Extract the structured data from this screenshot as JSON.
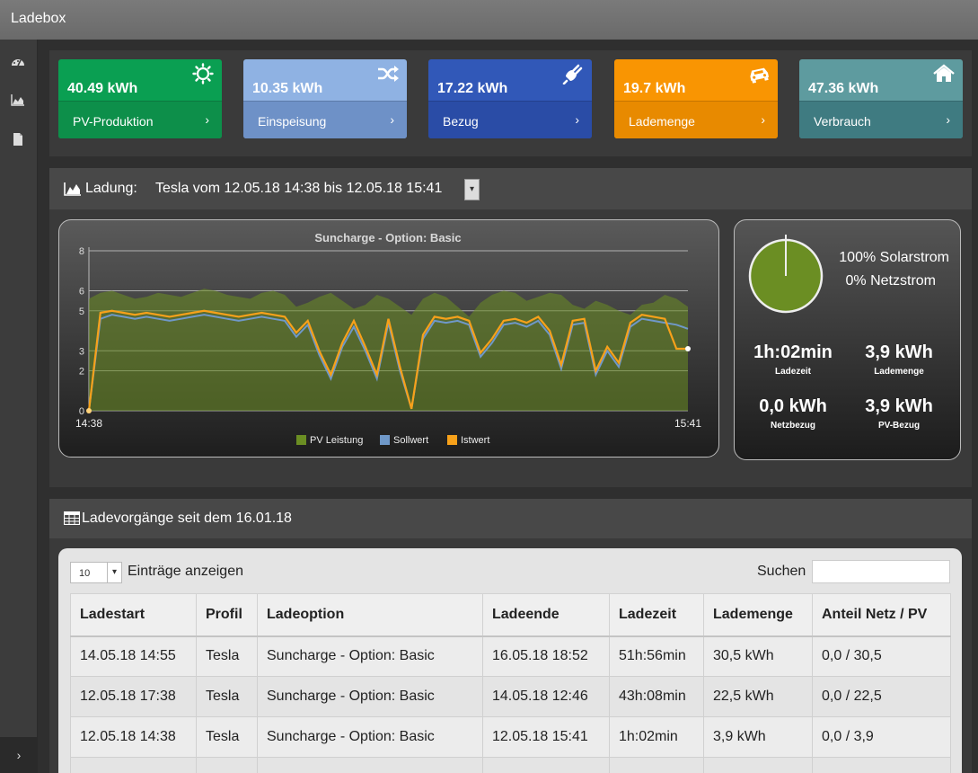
{
  "app": {
    "title": "Ladebox"
  },
  "sidebar": {
    "items": [
      {
        "icon": "dashboard-icon"
      },
      {
        "icon": "area-chart-icon"
      },
      {
        "icon": "document-icon"
      }
    ],
    "toggle_label": "›"
  },
  "tiles": [
    {
      "value": "40.49 kWh",
      "label": "PV-Produktion",
      "color": "#0a9f52",
      "foot_color": "#0d8f4a",
      "icon": "sun-icon"
    },
    {
      "value": "10.35 kWh",
      "label": "Einspeisung",
      "color": "#8fb2e3",
      "foot_color": "#6e91c7",
      "icon": "shuffle-icon"
    },
    {
      "value": "17.22 kWh",
      "label": "Bezug",
      "color": "#3158b8",
      "foot_color": "#2a4ca6",
      "icon": "plug-icon"
    },
    {
      "value": "19.7 kWh",
      "label": "Lademenge",
      "color": "#f99502",
      "foot_color": "#e88a00",
      "icon": "car-icon"
    },
    {
      "value": "47.36 kWh",
      "label": "Verbrauch",
      "color": "#5e9b9f",
      "foot_color": "#3f7b81",
      "icon": "home-icon"
    }
  ],
  "tile_chevron": "›",
  "ladung": {
    "label": "Ladung:",
    "session": "Tesla vom 12.05.18 14:38 bis 12.05.18 15:41",
    "dropdown_icon": "chevron-down-icon"
  },
  "chart_data": {
    "type": "area",
    "title": "Suncharge - Option: Basic",
    "x_start_label": "14:38",
    "x_end_label": "15:41",
    "ylim": [
      0,
      8
    ],
    "yticks": [
      0,
      2,
      3,
      5,
      6,
      8
    ],
    "grid": true,
    "legend_placement": "bottom",
    "series": [
      {
        "name": "PV Leistung",
        "type": "area",
        "color": "#6b8e23",
        "values": [
          5.6,
          5.9,
          6.0,
          5.8,
          5.6,
          5.7,
          5.9,
          5.8,
          5.7,
          5.9,
          6.1,
          6.0,
          5.8,
          5.7,
          5.6,
          5.9,
          6.0,
          5.8,
          5.2,
          5.4,
          5.7,
          5.9,
          5.5,
          5.1,
          5.3,
          5.8,
          5.6,
          5.2,
          4.8,
          5.6,
          5.9,
          5.7,
          5.2,
          4.7,
          5.4,
          5.8,
          6.0,
          5.9,
          5.5,
          5.7,
          5.9,
          5.8,
          5.3,
          5.1,
          5.5,
          5.3,
          5.0,
          4.8,
          5.3,
          5.4,
          5.8,
          5.6,
          5.2
        ]
      },
      {
        "name": "Sollwert",
        "type": "line",
        "color": "#6f98c8",
        "values": [
          0,
          4.6,
          4.8,
          4.7,
          4.6,
          4.7,
          4.6,
          4.5,
          4.6,
          4.7,
          4.8,
          4.7,
          4.6,
          4.5,
          4.6,
          4.7,
          4.6,
          4.5,
          3.7,
          4.3,
          2.8,
          1.6,
          3.2,
          4.2,
          3.0,
          1.6,
          4.4,
          2.0,
          0.1,
          3.6,
          4.5,
          4.4,
          4.5,
          4.3,
          2.7,
          3.4,
          4.3,
          4.4,
          4.2,
          4.5,
          3.8,
          2.1,
          4.3,
          4.4,
          1.8,
          3.0,
          2.2,
          4.2,
          4.6,
          4.5,
          4.4,
          4.3,
          4.1
        ]
      },
      {
        "name": "Istwert",
        "type": "line",
        "color": "#f7a11a",
        "values": [
          0,
          4.9,
          5.0,
          4.9,
          4.8,
          4.9,
          4.8,
          4.7,
          4.8,
          4.9,
          5.0,
          4.9,
          4.8,
          4.7,
          4.8,
          4.9,
          4.8,
          4.7,
          3.9,
          4.5,
          3.0,
          1.8,
          3.4,
          4.5,
          3.2,
          1.8,
          4.6,
          2.2,
          0.1,
          3.8,
          4.7,
          4.6,
          4.7,
          4.5,
          2.9,
          3.6,
          4.5,
          4.6,
          4.4,
          4.7,
          4.0,
          2.3,
          4.5,
          4.6,
          2.0,
          3.2,
          2.4,
          4.4,
          4.8,
          4.7,
          4.6,
          3.1,
          3.1
        ]
      }
    ]
  },
  "stats": {
    "solar_pct": "100% Solarstrom",
    "netz_pct": "0% Netzstrom",
    "pie_color": "#6b8e23",
    "items": [
      {
        "value": "1h:02min",
        "label": "Ladezeit"
      },
      {
        "value": "3,9 kWh",
        "label": "Lademenge"
      },
      {
        "value": "0,0 kWh",
        "label": "Netzbezug"
      },
      {
        "value": "3,9 kWh",
        "label": "PV-Bezug"
      }
    ]
  },
  "sessions": {
    "title": "Ladevorgänge seit dem 16.01.18",
    "icon": "table-icon",
    "page_length": "10",
    "length_label": "Einträge anzeigen",
    "search_label": "Suchen",
    "search_value": "",
    "columns": [
      "Ladestart",
      "Profil",
      "Ladeoption",
      "Ladeende",
      "Ladezeit",
      "Lademenge",
      "Anteil Netz / PV"
    ],
    "rows": [
      [
        "14.05.18 14:55",
        "Tesla",
        "Suncharge - Option: Basic",
        "16.05.18 18:52",
        "51h:56min",
        "30,5 kWh",
        "0,0 / 30,5"
      ],
      [
        "12.05.18 17:38",
        "Tesla",
        "Suncharge - Option: Basic",
        "14.05.18 12:46",
        "43h:08min",
        "22,5 kWh",
        "0,0 / 22,5"
      ],
      [
        "12.05.18 14:38",
        "Tesla",
        "Suncharge - Option: Basic",
        "12.05.18 15:41",
        "1h:02min",
        "3,9 kWh",
        "0,0 / 3,9"
      ]
    ]
  }
}
